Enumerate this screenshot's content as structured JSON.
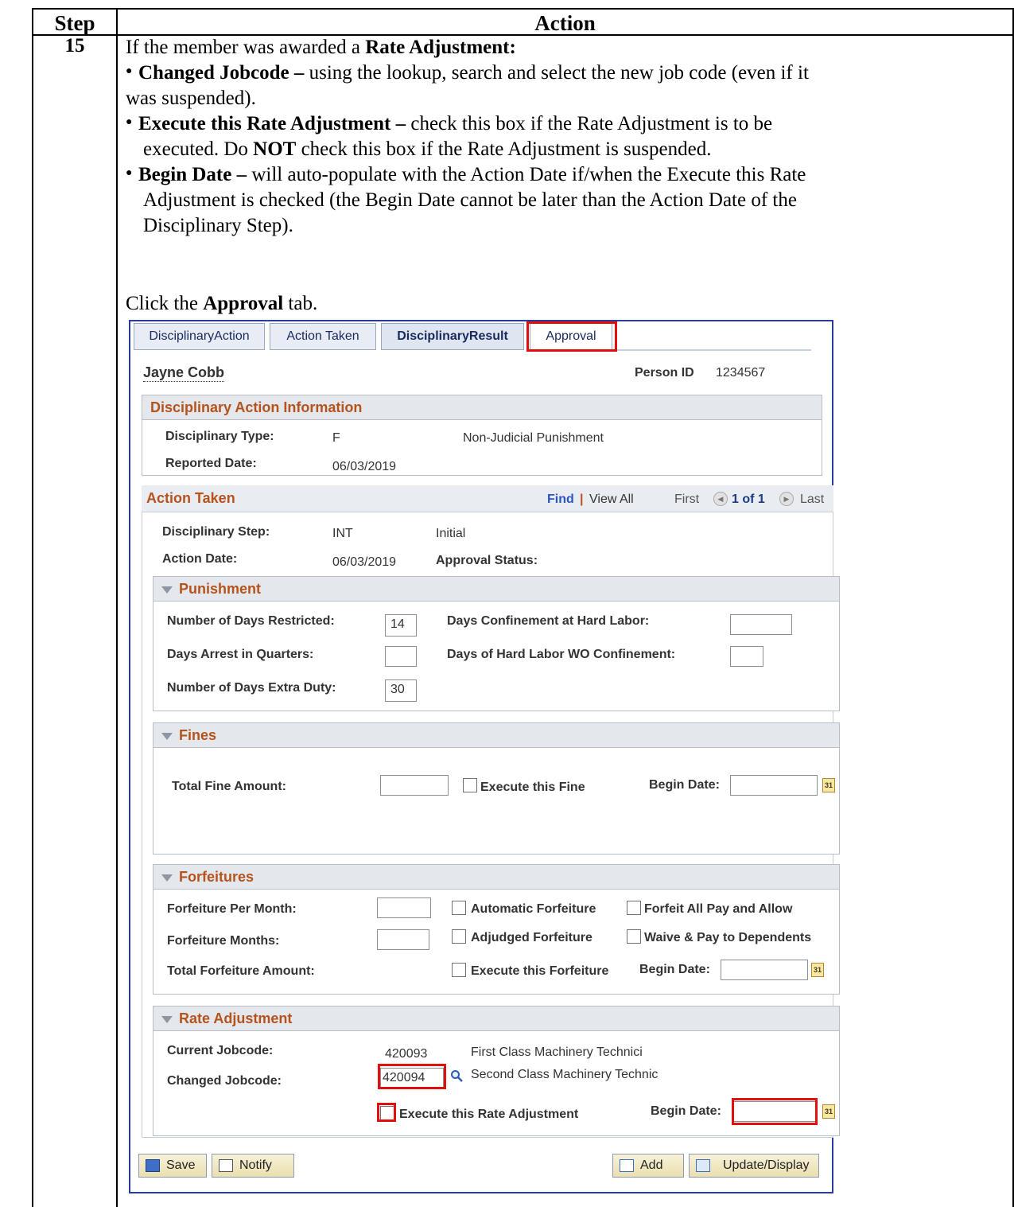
{
  "table": {
    "header_step": "Step",
    "header_action": "Action",
    "step_number": "15"
  },
  "instructions": {
    "intro_pre": "If the member was awarded a ",
    "intro_bold": "Rate Adjustment:",
    "b1_bold": "Changed Jobcode – ",
    "b1_l1": "using the lookup, search and select the new job code (even if it",
    "b1_l2": "was suspended).",
    "b2_bold": "Execute this Rate Adjustment – ",
    "b2_l1": "check this box if the Rate Adjustment is to be",
    "b2_l2a": "executed.  Do ",
    "b2_l2b": "NOT",
    "b2_l2c": " check this box if the Rate Adjustment is suspended.",
    "b3_bold": "Begin Date – ",
    "b3_l1": "will auto-populate with the Action Date if/when the Execute this Rate",
    "b3_l2": "Adjustment is checked (the Begin Date cannot be later than the Action Date of the",
    "b3_l3": "Disciplinary Step).",
    "click_pre": "Click the ",
    "click_bold": "Approval",
    "click_post": " tab."
  },
  "tabs": [
    "DisciplinaryAction",
    "Action Taken",
    "DisciplinaryResult",
    "Approval"
  ],
  "person": {
    "name": "Jayne Cobb",
    "id_label": "Person ID",
    "id_value": "1234567"
  },
  "info": {
    "title": "Disciplinary Action Information",
    "type_label": "Disciplinary Type:",
    "type_code": "F",
    "type_desc": "Non-Judicial Punishment",
    "reported_label": "Reported Date:",
    "reported_value": "06/03/2019"
  },
  "action_taken": {
    "title": "Action Taken",
    "find": "Find",
    "sep": "|",
    "view_all": "View All",
    "first": "First",
    "count": "1 of 1",
    "last": "Last",
    "step_label": "Disciplinary Step:",
    "step_code": "INT",
    "step_desc": "Initial",
    "date_label": "Action Date:",
    "date_value": "06/03/2019",
    "approval_label": "Approval Status:"
  },
  "punishment": {
    "title": "Punishment",
    "restricted_label": "Number of Days Restricted:",
    "restricted_value": "14",
    "hard_labor_label": "Days Confinement at Hard Labor:",
    "hard_labor_value": "",
    "arrest_label": "Days Arrest in Quarters:",
    "arrest_value": "",
    "hard_labor_wo_label": "Days of Hard Labor WO Confinement:",
    "hard_labor_wo_value": "",
    "extra_duty_label": "Number of Days Extra Duty:",
    "extra_duty_value": "30"
  },
  "fines": {
    "title": "Fines",
    "total_label": "Total Fine Amount:",
    "total_value": "",
    "execute_label": "Execute this Fine",
    "begin_label": "Begin Date:",
    "begin_value": ""
  },
  "forfeitures": {
    "title": "Forfeitures",
    "per_month_label": "Forfeiture Per Month:",
    "per_month_value": "",
    "automatic_label": "Automatic Forfeiture",
    "forfeit_all_label": "Forfeit All Pay and Allow",
    "months_label": "Forfeiture Months:",
    "months_value": "",
    "adjudged_label": "Adjudged Forfeiture",
    "waive_label": "Waive & Pay to Dependents",
    "total_label": "Total Forfeiture Amount:",
    "execute_label": "Execute this Forfeiture",
    "begin_label": "Begin Date:",
    "begin_value": ""
  },
  "rate": {
    "title": "Rate Adjustment",
    "current_label": "Current Jobcode:",
    "current_code": "420093",
    "current_desc": "First Class Machinery Technici",
    "changed_label": "Changed Jobcode:",
    "changed_code": "420094",
    "changed_desc": "Second Class Machinery Technic",
    "execute_label": "Execute this Rate Adjustment",
    "begin_label": "Begin Date:",
    "begin_value": ""
  },
  "buttons": {
    "save": "Save",
    "notify": "Notify",
    "add": "Add",
    "update": "Update/Display"
  },
  "icons": {
    "calendar": "calendar-icon",
    "lookup": "magnifier-icon"
  },
  "colors": {
    "highlight": "#e01010",
    "section_title": "#b5531d",
    "panel_border": "#2a3d9b"
  }
}
